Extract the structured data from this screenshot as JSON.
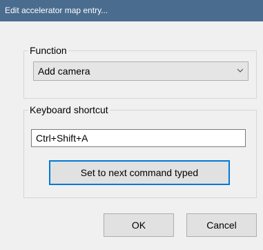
{
  "window": {
    "title": "Edit accelerator map entry..."
  },
  "function_group": {
    "label": "Function",
    "selected": "Add camera"
  },
  "shortcut_group": {
    "label": "Keyboard shortcut",
    "value": "Ctrl+Shift+A",
    "set_button_label": "Set to next command typed"
  },
  "actions": {
    "ok_label": "OK",
    "cancel_label": "Cancel"
  },
  "icons": {
    "dropdown": "chevron-down-icon"
  },
  "colors": {
    "titlebar": "#4a6c8f",
    "dialog_bg": "#f0f0f0",
    "accent": "#0078d7"
  }
}
